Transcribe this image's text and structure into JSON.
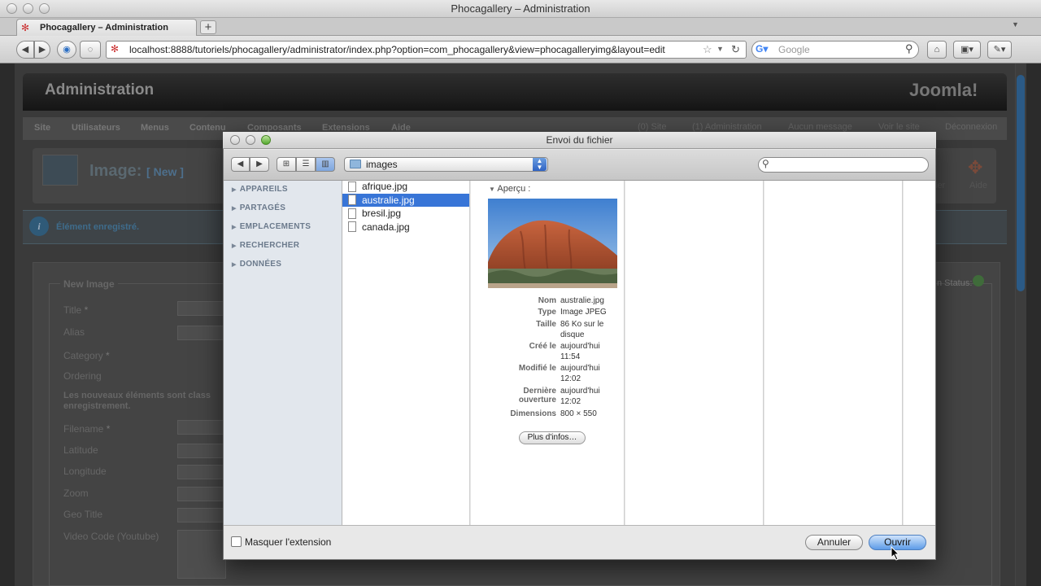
{
  "browser": {
    "window_title": "Phocagallery – Administration",
    "tab_label": "Phocagallery – Administration",
    "new_tab": "+",
    "url": "localhost:8888/tutoriels/phocagallery/administrator/index.php?option=com_phocagallery&view=phocagalleryimg&layout=edit",
    "search_placeholder": "Google"
  },
  "admin": {
    "title": "Administration",
    "logo": "Joomla!",
    "menu": [
      "Site",
      "Utilisateurs",
      "Menus",
      "Contenu",
      "Composants",
      "Extensions",
      "Aide"
    ],
    "status": {
      "site": "(0) Site",
      "admin": "(1) Administration",
      "messages": "Aucun message",
      "view_site": "Voir le site",
      "logout": "Déconnexion"
    },
    "page_title": "Image:",
    "page_subtitle": "[ New ]",
    "help_label": "Aide",
    "cancel_partial": "ler",
    "message": "Élément enregistré.",
    "form": {
      "legend": "New Image",
      "labels": [
        "Title",
        "Alias",
        "Category",
        "Ordering",
        "Les nouveaux éléments sont class",
        "enregistrement.",
        "Filename",
        "Latitude",
        "Longitude",
        "Zoom",
        "Geo Title",
        "Video Code (Youtube)"
      ],
      "required_mark": "*",
      "published_status": "n Status:"
    }
  },
  "dialog": {
    "title": "Envoi du fichier",
    "folder": "images",
    "sidebar": [
      "APPAREILS",
      "PARTAGÉS",
      "EMPLACEMENTS",
      "RECHERCHER",
      "DONNÉES"
    ],
    "files": [
      "afrique.jpg",
      "australie.jpg",
      "bresil.jpg",
      "canada.jpg"
    ],
    "selected_file": "australie.jpg",
    "preview_label": "Aperçu :",
    "info": {
      "nom_label": "Nom",
      "nom": "australie.jpg",
      "type_label": "Type",
      "type": "Image JPEG",
      "taille_label": "Taille",
      "taille": "86 Ko sur le disque",
      "cree_label": "Créé le",
      "cree": "aujourd'hui 11:54",
      "modifie_label": "Modifié le",
      "modifie": "aujourd'hui 12:02",
      "ouverture_label1": "Dernière",
      "ouverture_label2": "ouverture",
      "ouverture": "aujourd'hui 12:02",
      "dim_label": "Dimensions",
      "dim": "800 × 550"
    },
    "more_info": "Plus d'infos…",
    "hide_ext": "Masquer l'extension",
    "cancel": "Annuler",
    "open": "Ouvrir"
  }
}
